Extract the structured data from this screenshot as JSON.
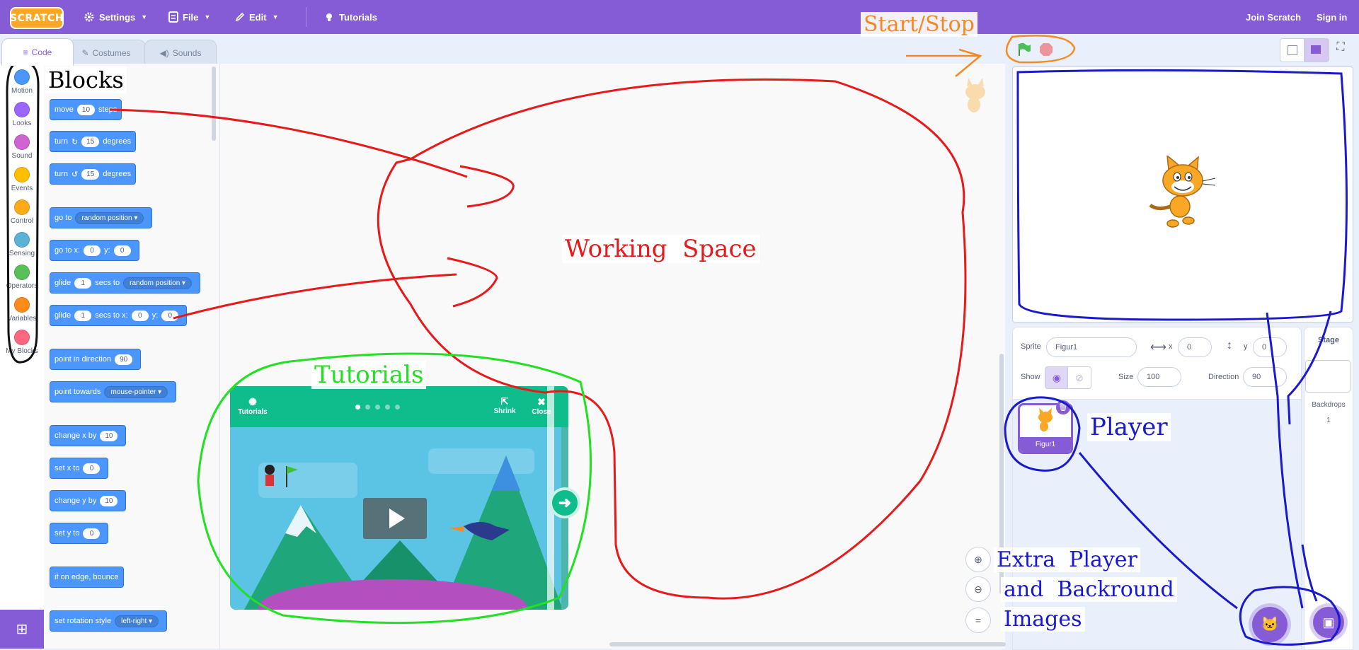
{
  "menu": {
    "logo": "SCRATCH",
    "settings": "Settings",
    "file": "File",
    "edit": "Edit",
    "tutorials": "Tutorials",
    "join": "Join Scratch",
    "signin": "Sign in"
  },
  "tabs": {
    "code": "Code",
    "costumes": "Costumes",
    "sounds": "Sounds"
  },
  "categories": [
    {
      "label": "Motion",
      "color": "#4c97ff"
    },
    {
      "label": "Looks",
      "color": "#9966ff"
    },
    {
      "label": "Sound",
      "color": "#cf63cf"
    },
    {
      "label": "Events",
      "color": "#ffbf00"
    },
    {
      "label": "Control",
      "color": "#ffab19"
    },
    {
      "label": "Sensing",
      "color": "#5cb1d6"
    },
    {
      "label": "Operators",
      "color": "#59c059"
    },
    {
      "label": "Variables",
      "color": "#ff8c1a"
    },
    {
      "label": "My Blocks",
      "color": "#ff6680"
    }
  ],
  "blocks": {
    "move": {
      "a": "move",
      "v": "10",
      "b": "steps"
    },
    "turn_right": {
      "a": "turn",
      "v": "15",
      "b": "degrees"
    },
    "turn_left": {
      "a": "turn",
      "v": "15",
      "b": "degrees"
    },
    "goto": {
      "a": "go to",
      "dd": "random position"
    },
    "goto_xy": {
      "a": "go to x:",
      "x": "0",
      "b": "y:",
      "y": "0"
    },
    "glide_to": {
      "a": "glide",
      "v": "1",
      "b": "secs to",
      "dd": "random position"
    },
    "glide_xy": {
      "a": "glide",
      "v": "1",
      "b": "secs to x:",
      "x": "0",
      "c": "y:",
      "y": "0"
    },
    "point_dir": {
      "a": "point in direction",
      "v": "90"
    },
    "point_towards": {
      "a": "point towards",
      "dd": "mouse-pointer"
    },
    "change_x": {
      "a": "change x by",
      "v": "10"
    },
    "set_x": {
      "a": "set x to",
      "v": "0"
    },
    "change_y": {
      "a": "change y by",
      "v": "10"
    },
    "set_y": {
      "a": "set y to",
      "v": "0"
    },
    "bounce": {
      "a": "if on edge, bounce"
    },
    "rotation": {
      "a": "set rotation style",
      "dd": "left-right"
    }
  },
  "tutorial": {
    "label": "Tutorials",
    "shrink": "Shrink",
    "close": "Close"
  },
  "sprite": {
    "sprite_label": "Sprite",
    "name": "Figur1",
    "x_label": "x",
    "x": "0",
    "y_label": "y",
    "y": "0",
    "show_label": "Show",
    "size_label": "Size",
    "size": "100",
    "direction_label": "Direction",
    "direction": "90",
    "thumb_name": "Figur1"
  },
  "stage_pane": {
    "title": "Stage",
    "backdrops_label": "Backdrops",
    "backdrops_count": "1"
  },
  "annotations": {
    "blocks": "Blocks",
    "working_space": "Working  Space",
    "tutorials": "Tutorials",
    "start_stop": "Start/Stop",
    "player": "Player",
    "extra1": "Extra  Player",
    "extra2": "and  Backround",
    "extra3": "Images"
  },
  "colors": {
    "menu": "#855cd6",
    "motion": "#4c97ff",
    "tutorial": "#0fbd8c",
    "red": "#e8191b",
    "green": "#22e022",
    "blue": "#1a1acc",
    "orange": "#f58a1f"
  }
}
